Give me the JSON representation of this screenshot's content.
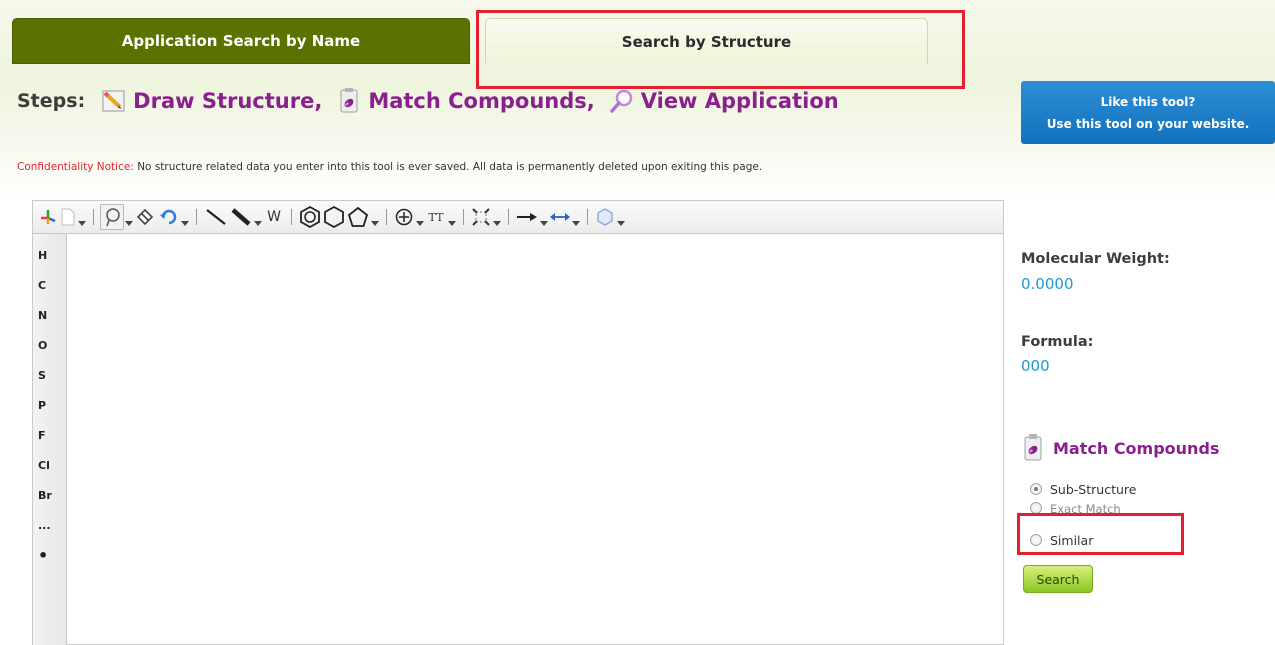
{
  "tabs": {
    "name_tab": "Application Search by Name",
    "structure_tab": "Search by Structure"
  },
  "steps": {
    "label": "Steps:",
    "draw": "Draw Structure,",
    "match": "Match Compounds,",
    "view": "View Application"
  },
  "promo": {
    "line1": "Like this tool?",
    "line2": "Use this tool on your website."
  },
  "notice": {
    "label": "Confidentiality Notice:",
    "text": " No structure related data you enter into this tool is ever saved. All data is permanently deleted upon exiting this page."
  },
  "toolbar": {
    "icons": [
      "structure-tool-icon",
      "new-document-icon",
      "lasso-select-icon",
      "eraser-icon",
      "undo-icon",
      "single-bond-icon",
      "bold-bond-icon",
      "chain-icon",
      "benzene-ring-icon",
      "hexagon-ring-icon",
      "pentagon-ring-icon",
      "charge-plus-icon",
      "text-tool-icon",
      "template-icon",
      "reaction-arrow-icon",
      "double-arrow-icon",
      "zoom-shape-icon"
    ],
    "chain_label": "W",
    "text_label": "TT"
  },
  "atoms": [
    "H",
    "C",
    "N",
    "O",
    "S",
    "P",
    "F",
    "Cl",
    "Br",
    "...",
    "•"
  ],
  "molecular": {
    "weight_label": "Molecular Weight:",
    "weight_value": "0.0000",
    "formula_label": "Formula:",
    "formula_value": "000"
  },
  "match_panel": {
    "title": "Match Compounds",
    "options": [
      {
        "label": "Sub-Structure",
        "checked": true
      },
      {
        "label": "Exact Match",
        "checked": false
      },
      {
        "label": "Similar",
        "checked": false
      }
    ],
    "search_label": "Search"
  },
  "colors": {
    "accent_purple": "#8a1f8e",
    "tab_green": "#5c7200",
    "value_blue": "#1a9ad6",
    "highlight_red": "#e2202f"
  }
}
